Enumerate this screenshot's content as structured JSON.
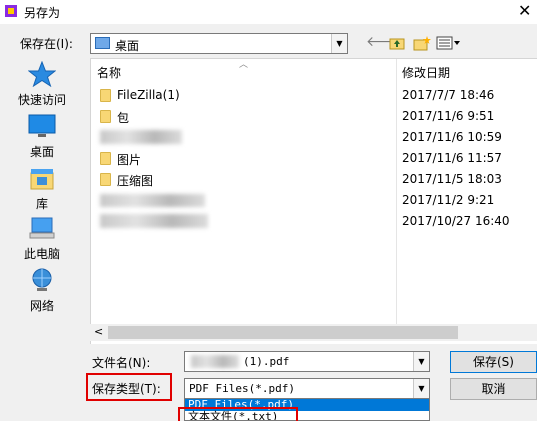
{
  "window": {
    "title": "另存为",
    "close_glyph": "✕"
  },
  "location": {
    "label": "保存在(I):",
    "current": "桌面"
  },
  "toolbar": {
    "back_icon": "back-arrow-icon",
    "up_icon": "up-folder-icon",
    "new_folder_icon": "new-folder-icon",
    "view_icon": "view-menu-icon"
  },
  "places": [
    {
      "label": "快速访问",
      "icon": "star-icon"
    },
    {
      "label": "桌面",
      "icon": "desktop-icon"
    },
    {
      "label": "库",
      "icon": "library-icon"
    },
    {
      "label": "此电脑",
      "icon": "computer-icon"
    },
    {
      "label": "网络",
      "icon": "network-icon"
    }
  ],
  "columns": {
    "name": "名称",
    "date": "修改日期"
  },
  "files": [
    {
      "name": "FileZilla(1)",
      "date": "2017/7/7 18:46"
    },
    {
      "name": "包",
      "date": "2017/11/6 9:51"
    },
    {
      "name": "",
      "date": "2017/11/6 10:59"
    },
    {
      "name": "图片",
      "date": "2017/11/6 11:57"
    },
    {
      "name": "压缩图",
      "date": "2017/11/5 18:03"
    },
    {
      "name": "",
      "date": "2017/11/2 9:21"
    },
    {
      "name": "",
      "date": "2017/10/27 16:40"
    }
  ],
  "form": {
    "filename_label": "文件名(N):",
    "filename_value": "(1).pdf",
    "filetype_label": "保存类型(T):",
    "filetype_value": "PDF Files(*.pdf)",
    "filetype_options": [
      "PDF Files(*.pdf)",
      "文本文件(*.txt)"
    ]
  },
  "buttons": {
    "save": "保存(S)",
    "cancel": "取消"
  },
  "colors": {
    "highlight": "#0078d7",
    "annotation_box": "#e00000",
    "folder": "#f8d775"
  }
}
